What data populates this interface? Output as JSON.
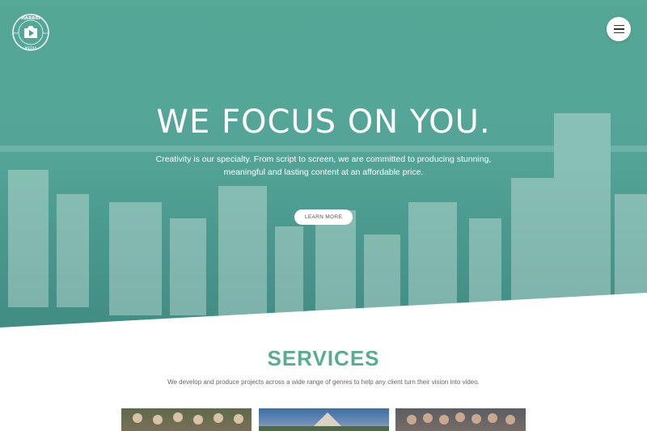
{
  "header": {
    "logo_top_text": "HARBRI",
    "logo_bottom_text": "MEDIA",
    "logo_left_text": "EST",
    "logo_right_text": "2014",
    "menu_icon": "hamburger-icon"
  },
  "hero": {
    "title": "WE FOCUS ON YOU.",
    "subtitle": "Creativity is our specialty. From script to screen, we are committed to producing stunning, meaningful and lasting content at an affordable price.",
    "cta_label": "LEARN MORE"
  },
  "services": {
    "title": "SERVICES",
    "description": "We develop and produce projects across a wide range of genres to help any client turn their vision into video."
  },
  "colors": {
    "hero_teal": "#48a08c",
    "services_accent": "#56ad90"
  }
}
